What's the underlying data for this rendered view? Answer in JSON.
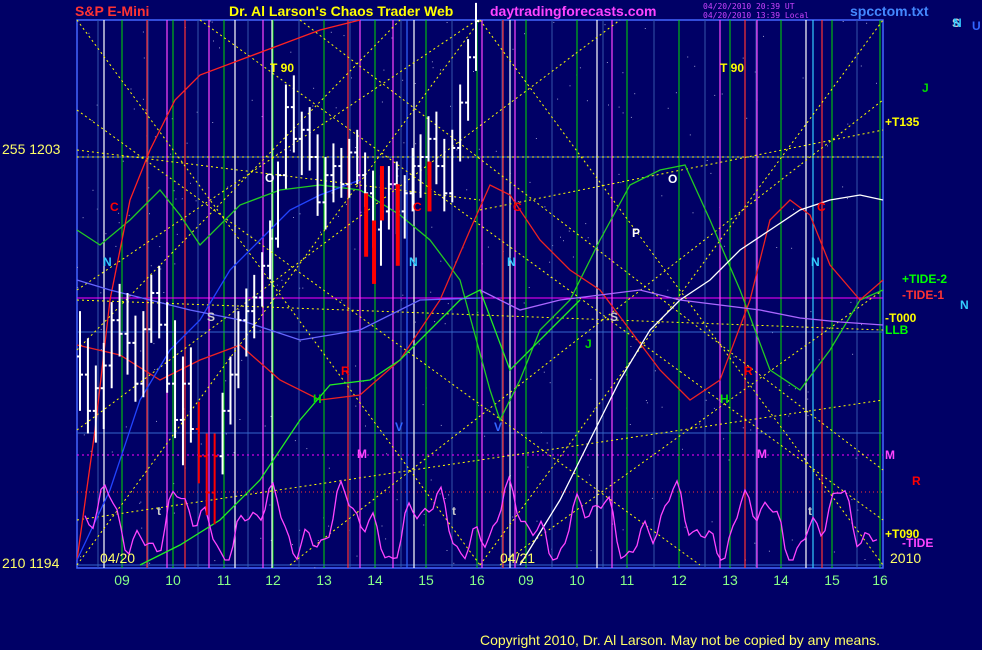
{
  "header": {
    "left_title": "S&P E-Mini",
    "center_title": "Dr. Al Larson's Chaos Trader Web",
    "site": "daytradingforecasts.com",
    "stamp1": "04/20/2010 20:39 UT",
    "stamp2": "04/20/2010 13:39 Local",
    "file": "spcctom.txt"
  },
  "copyright": "Copyright 2010, Dr. Al Larson. May not be copied by any means.",
  "colors": {
    "background": "#000066",
    "grid_blue": "#4466ff",
    "price_bars": "#ffffff",
    "ce_bars": "#ff0000",
    "tide": "#ff44ff",
    "yellow": "#ffff00",
    "green": "#00dd00",
    "red": "#ff0000",
    "purple": "#ff00ff",
    "cyan": "#33ccff"
  },
  "chart_data": {
    "type": "line",
    "title": "S&P E-Mini",
    "y_left_labels": [
      {
        "text": "255  1203",
        "value": 1203
      },
      {
        "text": "210  1194",
        "value": 1194
      }
    ],
    "ylim": [
      1194,
      1203
    ],
    "date_markers": [
      "04/20",
      "04/21",
      "2010"
    ],
    "x_ticks": [
      "09",
      "10",
      "11",
      "12",
      "13",
      "14",
      "15",
      "16",
      "09",
      "10",
      "11",
      "12",
      "13",
      "14",
      "15",
      "16"
    ],
    "ohlc": [
      [
        1198.6,
        1199.6,
        1197.4,
        1198.2
      ],
      [
        1198.2,
        1199.0,
        1196.9,
        1197.4
      ],
      [
        1197.4,
        1198.4,
        1196.7,
        1197.9
      ],
      [
        1197.9,
        1198.9,
        1197.0,
        1198.4
      ],
      [
        1198.4,
        1199.8,
        1197.9,
        1199.4
      ],
      [
        1199.4,
        1200.2,
        1198.6,
        1199.1
      ],
      [
        1199.1,
        1200.0,
        1198.2,
        1198.9
      ],
      [
        1198.9,
        1199.5,
        1197.6,
        1198.0
      ],
      [
        1198.0,
        1199.6,
        1197.7,
        1199.2
      ],
      [
        1199.2,
        1200.4,
        1198.9,
        1200.0
      ],
      [
        1200.0,
        1200.6,
        1199.0,
        1199.3
      ],
      [
        1199.3,
        1199.8,
        1197.8,
        1198.0
      ],
      [
        1198.0,
        1199.4,
        1196.8,
        1197.2
      ],
      [
        1197.2,
        1198.6,
        1196.2,
        1198.0
      ],
      [
        1198.0,
        1198.8,
        1196.7,
        1197.0
      ],
      [
        1197.0,
        1197.6,
        1195.8,
        1196.4
      ],
      [
        1196.4,
        1196.9,
        1195.1,
        1195.6
      ],
      [
        1195.6,
        1196.9,
        1194.9,
        1196.4
      ],
      [
        1196.4,
        1197.8,
        1196.0,
        1197.4
      ],
      [
        1197.4,
        1198.6,
        1197.1,
        1198.2
      ],
      [
        1198.2,
        1199.6,
        1197.9,
        1199.4
      ],
      [
        1199.4,
        1200.1,
        1198.6,
        1199.6
      ],
      [
        1199.6,
        1200.4,
        1199.0,
        1199.9
      ],
      [
        1199.9,
        1200.9,
        1199.7,
        1200.6
      ],
      [
        1200.6,
        1201.6,
        1200.3,
        1201.2
      ],
      [
        1201.2,
        1202.9,
        1201.0,
        1202.6
      ],
      [
        1202.6,
        1204.6,
        1202.3,
        1204.1
      ],
      [
        1204.1,
        1204.8,
        1203.1,
        1203.4
      ],
      [
        1203.4,
        1204.0,
        1202.6,
        1203.6
      ],
      [
        1203.6,
        1204.1,
        1202.7,
        1203.0
      ],
      [
        1203.0,
        1203.5,
        1201.7,
        1202.0
      ],
      [
        1202.0,
        1203.0,
        1201.4,
        1202.6
      ],
      [
        1202.6,
        1203.3,
        1202.0,
        1202.8
      ],
      [
        1202.8,
        1203.2,
        1202.1,
        1202.4
      ],
      [
        1202.4,
        1203.4,
        1202.1,
        1203.1
      ],
      [
        1203.1,
        1203.6,
        1202.4,
        1202.6
      ],
      [
        1202.6,
        1203.1,
        1201.9,
        1202.2
      ],
      [
        1202.2,
        1202.7,
        1201.0,
        1201.4
      ],
      [
        1201.4,
        1202.6,
        1200.6,
        1201.8
      ],
      [
        1201.8,
        1202.8,
        1201.4,
        1202.4
      ],
      [
        1202.4,
        1202.9,
        1201.3,
        1201.8
      ],
      [
        1201.8,
        1202.6,
        1201.2,
        1202.2
      ],
      [
        1202.2,
        1203.2,
        1201.8,
        1202.8
      ],
      [
        1202.8,
        1203.5,
        1202.1,
        1203.0
      ],
      [
        1203.0,
        1203.9,
        1202.6,
        1203.4
      ],
      [
        1203.4,
        1204.0,
        1202.4,
        1202.8
      ],
      [
        1202.8,
        1203.4,
        1201.8,
        1202.2
      ],
      [
        1202.2,
        1203.6,
        1202.0,
        1203.2
      ],
      [
        1203.2,
        1204.6,
        1202.9,
        1204.2
      ],
      [
        1204.2,
        1205.6,
        1203.8,
        1205.2
      ],
      [
        1205.2,
        1206.4,
        1204.9,
        1206.0
      ]
    ],
    "ce_red_bars": [
      [
        1202.2,
        1200.8
      ],
      [
        1201.6,
        1200.2
      ],
      [
        1202.8,
        1201.6
      ],
      [
        1202.4,
        1200.6
      ],
      [
        1202.9,
        1201.8
      ]
    ],
    "ce_red_bar_indices": [
      36,
      37,
      38,
      40,
      44
    ],
    "ce_red_low_indices": [
      15,
      16,
      17
    ],
    "right_labels": [
      {
        "text": "+T135",
        "color": "#ffff00"
      },
      {
        "text": "J",
        "color": "#00dd00"
      },
      {
        "text": "+TIDE-2",
        "color": "#00ff00"
      },
      {
        "text": "-TIDE-1",
        "color": "#ff3333"
      },
      {
        "text": "-T000",
        "color": "#ffff00"
      },
      {
        "text": "LLB",
        "color": "#00ff00"
      },
      {
        "text": "N",
        "color": "#33ccff"
      },
      {
        "text": "M",
        "color": "#ff44ff"
      },
      {
        "text": "R",
        "color": "#ff0000"
      },
      {
        "text": "+T090",
        "color": "#ffff00"
      },
      {
        "text": "-TIDE",
        "color": "#ff44ff"
      },
      {
        "text": "S",
        "color": "#cccccc"
      },
      {
        "text": "U",
        "color": "#3366ff"
      }
    ],
    "annotations": [
      {
        "text": "T  90",
        "color": "#ffff00"
      },
      {
        "text": "T  90",
        "color": "#ffff00"
      },
      {
        "text": "C",
        "color": "#ff0000"
      },
      {
        "text": "C",
        "color": "#ff0000"
      },
      {
        "text": "C",
        "color": "#ff0000"
      },
      {
        "text": "C",
        "color": "#ff0000"
      },
      {
        "text": "N",
        "color": "#33ccff"
      },
      {
        "text": "N",
        "color": "#33ccff"
      },
      {
        "text": "N",
        "color": "#33ccff"
      },
      {
        "text": "N",
        "color": "#33ccff"
      },
      {
        "text": "N",
        "color": "#33ccff"
      },
      {
        "text": "S",
        "color": "#cccccc"
      },
      {
        "text": "S",
        "color": "#cccccc"
      },
      {
        "text": "H",
        "color": "#00dd00"
      },
      {
        "text": "H",
        "color": "#00dd00"
      },
      {
        "text": "R",
        "color": "#ff0000"
      },
      {
        "text": "R",
        "color": "#ff0000"
      },
      {
        "text": "V",
        "color": "#3366ff"
      },
      {
        "text": "V",
        "color": "#3366ff"
      },
      {
        "text": "M",
        "color": "#ff44ff"
      },
      {
        "text": "M",
        "color": "#ff44ff"
      },
      {
        "text": "O",
        "color": "#ffffff"
      },
      {
        "text": "O",
        "color": "#ffffff"
      },
      {
        "text": "P",
        "color": "#ffffff"
      },
      {
        "text": "J",
        "color": "#00dd00"
      },
      {
        "text": "t",
        "color": "#cccccc"
      },
      {
        "text": "t",
        "color": "#cccccc"
      },
      {
        "text": "t",
        "color": "#cccccc"
      }
    ]
  }
}
